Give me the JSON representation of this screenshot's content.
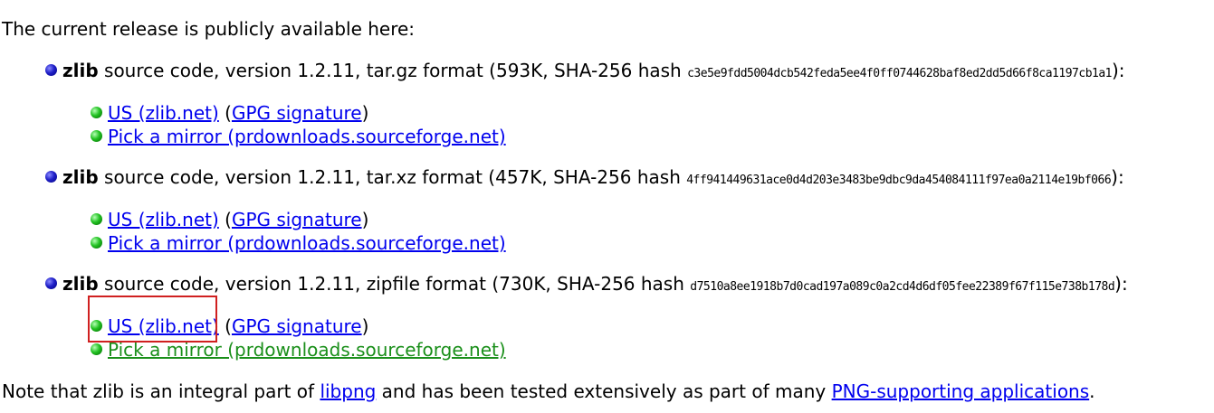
{
  "intro_text": "The current release is publicly available here:",
  "downloads": [
    {
      "name": "zlib",
      "description": " source code, version 1.2.11, tar.gz format (593K, SHA-256 hash ",
      "hash": "c3e5e9fdd5004dcb542feda5ee4f0ff0744628baf8ed2dd5d66f8ca1197cb1a1",
      "suffix": "):",
      "us_link": "US (zlib.net)",
      "gpg_open": "(",
      "gpg_link": "GPG signature",
      "gpg_close": ")",
      "mirror_link": "Pick a mirror (prdownloads.sourceforge.net)"
    },
    {
      "name": "zlib",
      "description": " source code, version 1.2.11, tar.xz format (457K, SHA-256 hash ",
      "hash": "4ff941449631ace0d4d203e3483be9dbc9da454084111f97ea0a2114e19bf066",
      "suffix": "):",
      "us_link": "US (zlib.net)",
      "gpg_open": "(",
      "gpg_link": "GPG signature",
      "gpg_close": ")",
      "mirror_link": "Pick a mirror (prdownloads.sourceforge.net)"
    },
    {
      "name": "zlib",
      "description": " source code, version 1.2.11, zipfile format (730K, SHA-256 hash ",
      "hash": "d7510a8ee1918b7d0cad197a089c0a2cd4d6df05fee22389f67f115e738b178d",
      "suffix": "):",
      "us_link": "US (zlib.net)",
      "gpg_open": "(",
      "gpg_link": "GPG signature",
      "gpg_close": ")",
      "mirror_link": "Pick a mirror (prdownloads.sourceforge.net)"
    }
  ],
  "note": {
    "before": "Note that zlib is an integral part of ",
    "libpng_link": "libpng",
    "middle": " and has been tested extensively as part of many ",
    "png_apps_link": "PNG-supporting applications",
    "after": "."
  },
  "colors": {
    "link": "#0000ee",
    "visited_link": "#1a8f1a",
    "highlight_box": "#d02020"
  }
}
